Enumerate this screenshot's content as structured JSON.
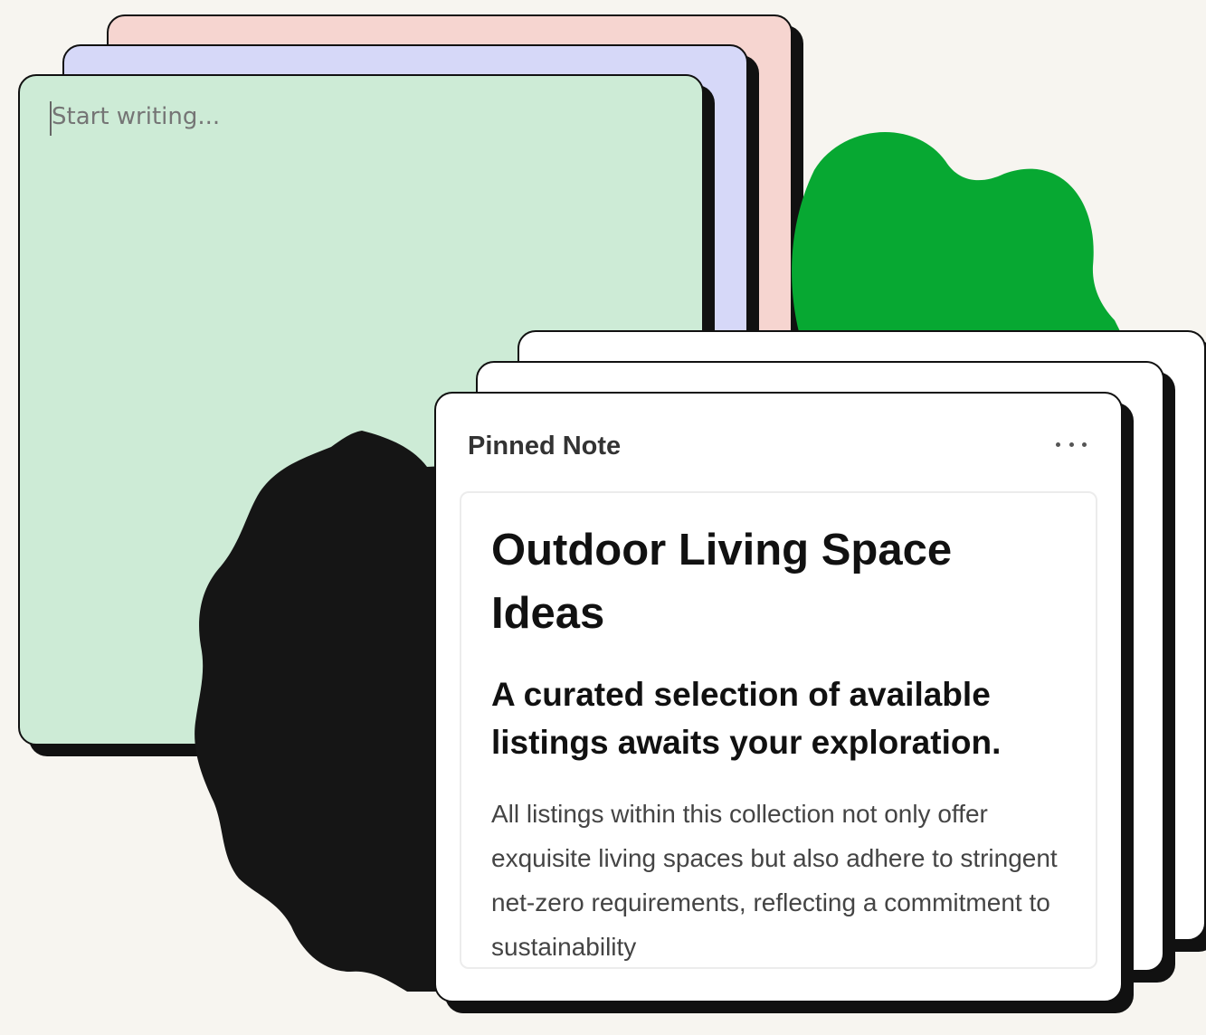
{
  "editor": {
    "placeholder": "Start writing..."
  },
  "pinned_note": {
    "header": "Pinned Note",
    "title": "Outdoor Living Space Ideas",
    "subtitle": "A curated selection of available listings awaits your exploration.",
    "body": "All listings within this collection not only offer exquisite living spaces but also adhere to stringent net-zero requirements, reflecting a commitment to sustainability"
  },
  "icons": {
    "more": "more-options-icon",
    "cloud": "cloud-shape",
    "blob": "wavy-blob-shape"
  },
  "colors": {
    "background": "#f7f5f0",
    "pink_note": "#f6d5d0",
    "lavender_note": "#d6d8f8",
    "green_note": "#cdebd6",
    "cloud": "#07a832",
    "blob": "#151515",
    "pinned_card": "#ffffff"
  }
}
